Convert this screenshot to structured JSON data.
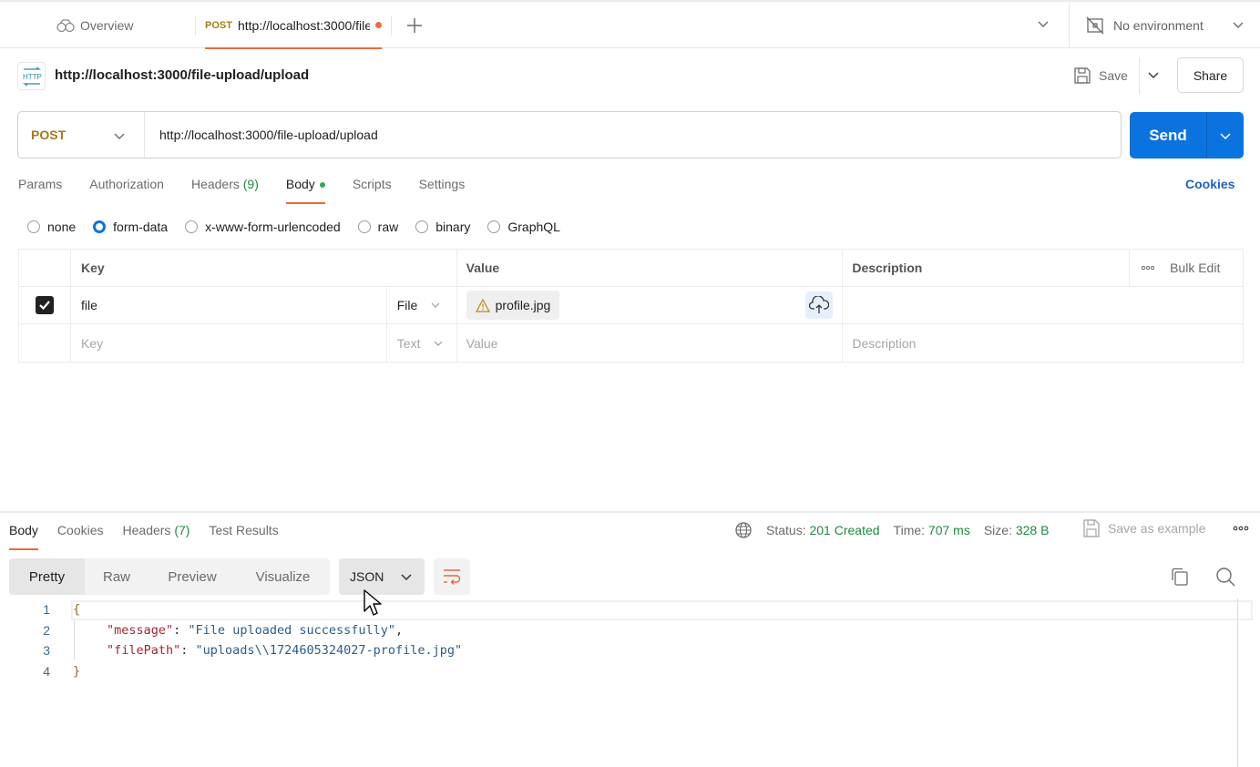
{
  "tabbar": {
    "overview_label": "Overview",
    "active_tab": {
      "method": "POST",
      "url": "http://localhost:3000/file-upload/upload",
      "unsaved": true
    },
    "new_tab_icon": "plus-icon",
    "environment_label": "No environment"
  },
  "request": {
    "title": "http://localhost:3000/file-upload/upload",
    "save_label": "Save",
    "share_label": "Share",
    "method": "POST",
    "url": "http://localhost:3000/file-upload/upload",
    "send_label": "Send",
    "cookies_label": "Cookies",
    "tabs": [
      {
        "label": "Params"
      },
      {
        "label": "Authorization"
      },
      {
        "label": "Headers",
        "count": "(9)"
      },
      {
        "label": "Body",
        "active": true,
        "indicator": true
      },
      {
        "label": "Scripts"
      },
      {
        "label": "Settings"
      }
    ],
    "body_types": [
      {
        "label": "none",
        "checked": false
      },
      {
        "label": "form-data",
        "checked": true
      },
      {
        "label": "x-www-form-urlencoded",
        "checked": false
      },
      {
        "label": "raw",
        "checked": false
      },
      {
        "label": "binary",
        "checked": false
      },
      {
        "label": "GraphQL",
        "checked": false
      }
    ],
    "form_table": {
      "headers": {
        "key": "Key",
        "value": "Value",
        "description": "Description",
        "bulk_edit": "Bulk Edit"
      },
      "rows": [
        {
          "checked": true,
          "key": "file",
          "type": "File",
          "value": "profile.jpg",
          "value_warning": true,
          "description": ""
        }
      ],
      "empty_row": {
        "key_placeholder": "Key",
        "type": "Text",
        "value_placeholder": "Value",
        "description_placeholder": "Description"
      }
    }
  },
  "response": {
    "tabs": [
      {
        "label": "Body",
        "active": true
      },
      {
        "label": "Cookies"
      },
      {
        "label": "Headers",
        "count": "(7)"
      },
      {
        "label": "Test Results"
      }
    ],
    "status_label": "Status:",
    "status_value": "201 Created",
    "time_label": "Time:",
    "time_value": "707 ms",
    "size_label": "Size:",
    "size_value": "328 B",
    "save_example_label": "Save as example",
    "view_modes": [
      "Pretty",
      "Raw",
      "Preview",
      "Visualize"
    ],
    "active_view_mode": "Pretty",
    "format": "JSON",
    "code_lines": [
      {
        "n": "1",
        "open": "{"
      },
      {
        "n": "2",
        "key": "\"message\"",
        "value": "\"File uploaded successfully\"",
        "trail": ","
      },
      {
        "n": "3",
        "key": "\"filePath\"",
        "value": "\"uploads\\\\1724605324027-profile.jpg\"",
        "trail": ""
      },
      {
        "n": "4",
        "close": "}"
      }
    ]
  },
  "colors": {
    "accent_orange": "#e86a3c",
    "send_blue": "#0b73e0",
    "method_post": "#a57b17",
    "success_green": "#1d8a40",
    "link_blue": "#1a64c0"
  }
}
